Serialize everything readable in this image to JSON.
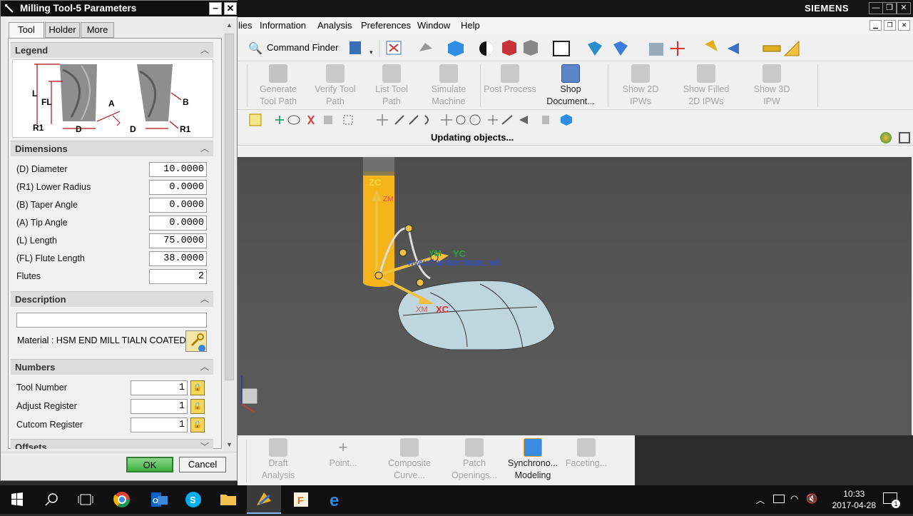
{
  "window": {
    "brand": "SIEMENS",
    "controls": [
      "—",
      "❐",
      "✕"
    ]
  },
  "menu": {
    "items": [
      "lies",
      "Information",
      "Analysis",
      "Preferences",
      "Window",
      "Help"
    ]
  },
  "toolbar": {
    "command_finder": "Command Finder"
  },
  "ribbon": {
    "items": [
      {
        "label1": "Generate",
        "label2": "Tool Path",
        "enabled": false
      },
      {
        "label1": "Verify Tool",
        "label2": "Path",
        "enabled": false
      },
      {
        "label1": "List Tool",
        "label2": "Path",
        "enabled": false
      },
      {
        "label1": "Simulate",
        "label2": "Machine",
        "enabled": false
      },
      {
        "label1": "Post Process",
        "label2": "",
        "enabled": false
      },
      {
        "label1": "Shop",
        "label2": "Document...",
        "enabled": true
      },
      {
        "label1": "Show 2D",
        "label2": "IPWs",
        "enabled": false
      },
      {
        "label1": "Show Filled",
        "label2": "2D IPWs",
        "enabled": false
      },
      {
        "label1": "Show 3D",
        "label2": "IPW",
        "enabled": false
      }
    ]
  },
  "status": {
    "text": "Updating objects..."
  },
  "viewport": {
    "watermark": "www.thundershare.net",
    "axes": {
      "zc": "ZC",
      "zm": "ZM",
      "yc": "YC",
      "ym": "YM",
      "xc": "XC",
      "xm": "XM"
    }
  },
  "bottom_ribbon": {
    "items": [
      {
        "label1": "Draft",
        "label2": "Analysis",
        "enabled": false
      },
      {
        "label1": "Point...",
        "label2": "",
        "enabled": false
      },
      {
        "label1": "Composite",
        "label2": "Curve...",
        "enabled": false
      },
      {
        "label1": "Patch",
        "label2": "Openings...",
        "enabled": false
      },
      {
        "label1": "Synchrono...",
        "label2": "Modeling",
        "enabled": true
      },
      {
        "label1": "Faceting...",
        "label2": "",
        "enabled": false
      }
    ]
  },
  "dialog": {
    "title": "Milling Tool-5 Parameters",
    "tabs": [
      "Tool",
      "Holder",
      "More"
    ],
    "active_tab": "Tool",
    "legend": {
      "title": "Legend",
      "labels": {
        "l": "L",
        "fl": "FL",
        "r1": "R1",
        "d": "D",
        "a": "A",
        "b": "B"
      }
    },
    "dimensions": {
      "title": "Dimensions",
      "fields": [
        {
          "label": "(D) Diameter",
          "value": "10.0000"
        },
        {
          "label": "(R1) Lower Radius",
          "value": "0.0000"
        },
        {
          "label": "(B) Taper Angle",
          "value": "0.0000"
        },
        {
          "label": "(A) Tip Angle",
          "value": "0.0000"
        },
        {
          "label": "(L) Length",
          "value": "75.0000"
        },
        {
          "label": "(FL) Flute Length",
          "value": "38.0000"
        },
        {
          "label": "Flutes",
          "value": "2"
        }
      ]
    },
    "description": {
      "title": "Description",
      "value": "",
      "material_label": "Material : HSM END MILL TIALN COATED"
    },
    "numbers": {
      "title": "Numbers",
      "fields": [
        {
          "label": "Tool Number",
          "value": "1"
        },
        {
          "label": "Adjust Register",
          "value": "1"
        },
        {
          "label": "Cutcom Register",
          "value": "1"
        }
      ]
    },
    "offsets": {
      "title": "Offsets"
    },
    "ok_label": "OK",
    "cancel_label": "Cancel"
  },
  "taskbar": {
    "time": "10:33",
    "date": "2017-04-28",
    "notifications": "1"
  }
}
